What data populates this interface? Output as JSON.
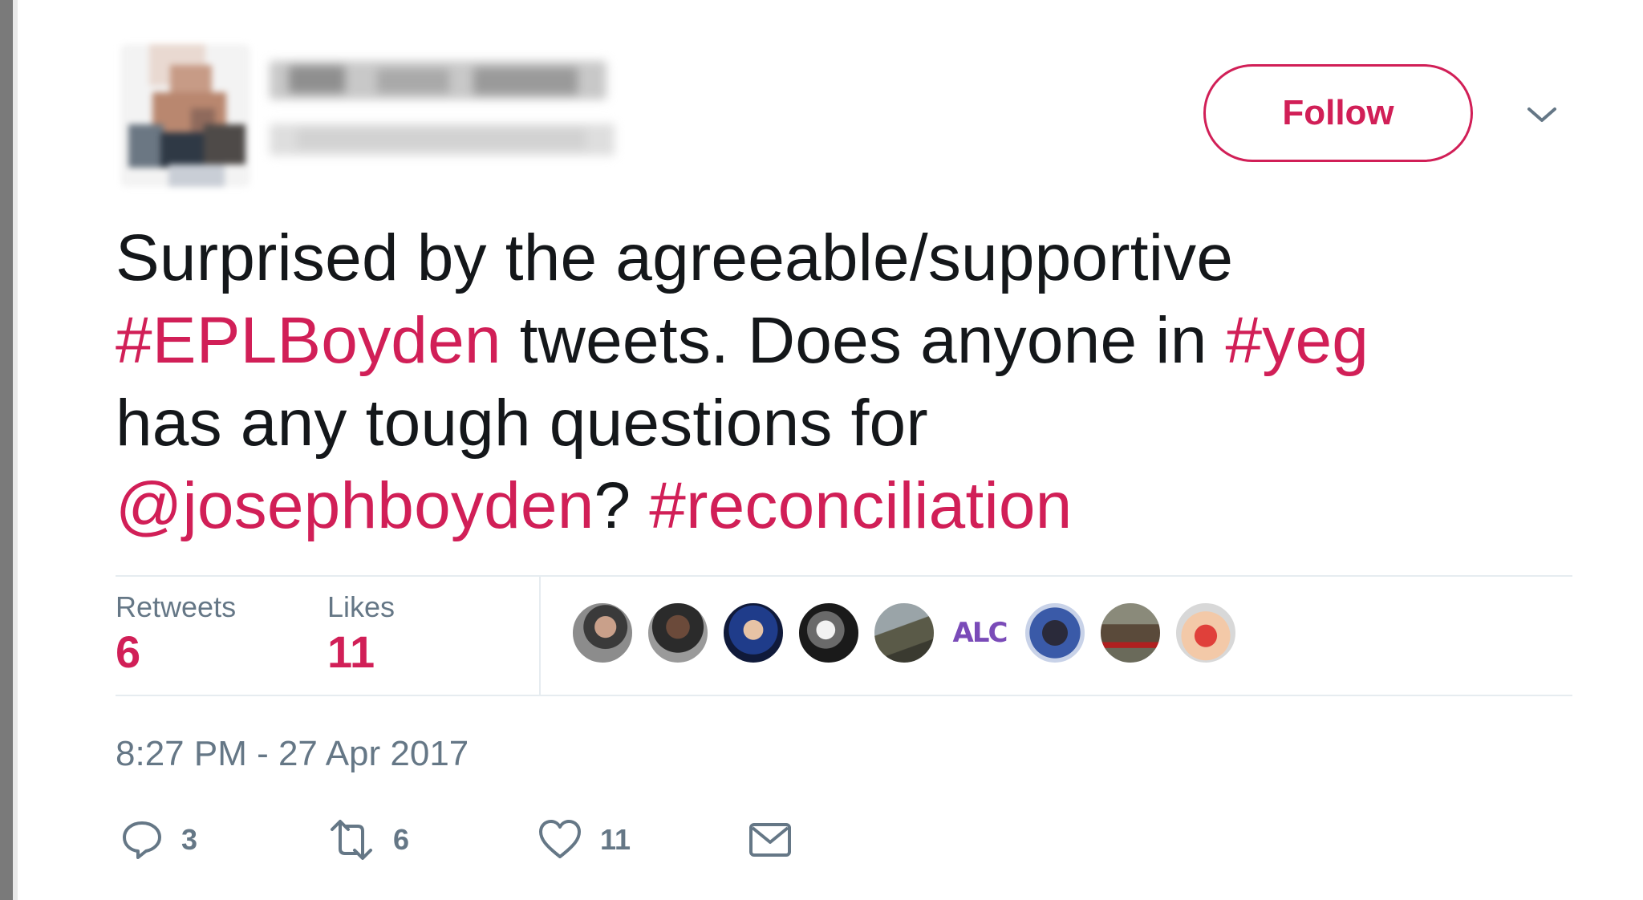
{
  "header": {
    "follow_label": "Follow",
    "caret_icon": "chevron-down-icon"
  },
  "tweet": {
    "segments": [
      {
        "text": "Surprised by the agreeable/supportive",
        "link": false
      },
      {
        "text": "#EPLBoyden",
        "link": true
      },
      {
        "text": " tweets. Does anyone in ",
        "link": false
      },
      {
        "text": "#yeg",
        "link": true
      },
      {
        "text": "has any tough questions for",
        "link": false
      },
      {
        "text": "@josephboyden",
        "link": true
      },
      {
        "text": "? ",
        "link": false
      },
      {
        "text": "#reconciliation",
        "link": true
      }
    ]
  },
  "stats": {
    "retweets_label": "Retweets",
    "retweets_value": "6",
    "likes_label": "Likes",
    "likes_value": "11"
  },
  "likers": [
    {
      "name": "liker-avatar-1"
    },
    {
      "name": "liker-avatar-2"
    },
    {
      "name": "liker-avatar-3"
    },
    {
      "name": "liker-avatar-4"
    },
    {
      "name": "liker-avatar-5"
    },
    {
      "name": "liker-avatar-6",
      "text": "ALC"
    },
    {
      "name": "liker-avatar-7"
    },
    {
      "name": "liker-avatar-8"
    },
    {
      "name": "liker-avatar-9"
    }
  ],
  "timestamp": "8:27 PM - 27 Apr 2017",
  "actions": {
    "reply_count": "3",
    "retweet_count": "6",
    "like_count": "11"
  },
  "colors": {
    "accent": "#d11f57",
    "text": "#14171a",
    "muted": "#657786",
    "divider": "#e6ecf0"
  }
}
